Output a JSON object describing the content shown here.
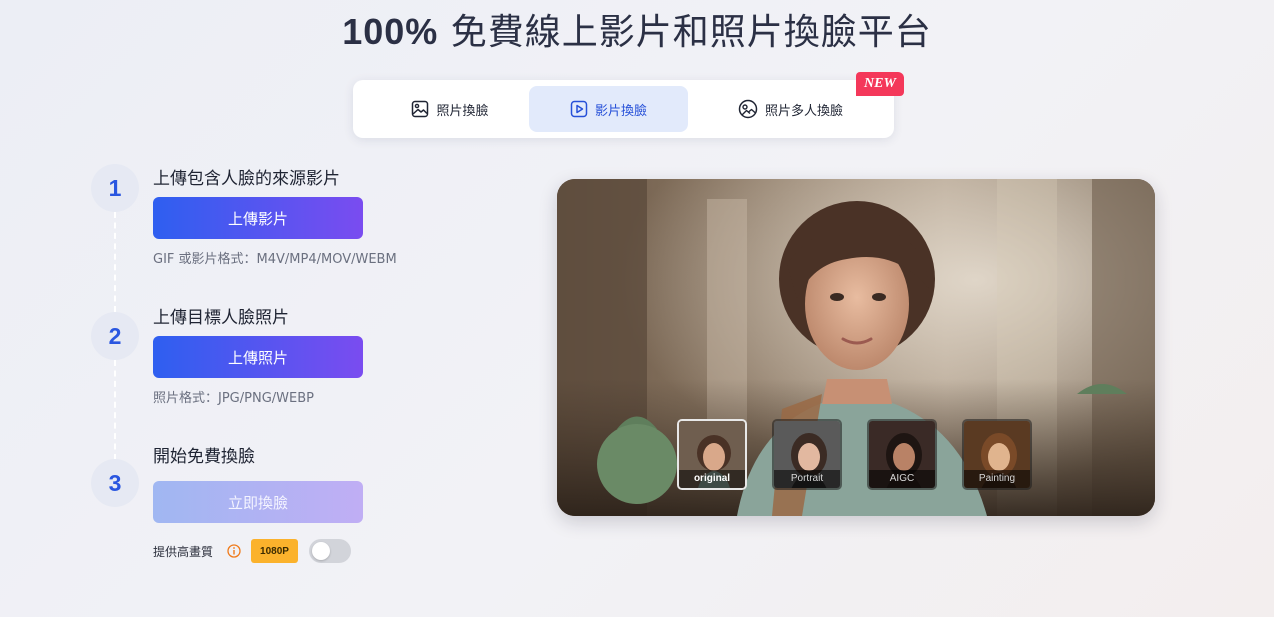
{
  "page": {
    "title_pct": "100%",
    "title_rest": " 免費線上影片和照片換臉平台"
  },
  "tabs": [
    {
      "label": "照片換臉",
      "icon": "image-icon",
      "active": false
    },
    {
      "label": "影片換臉",
      "icon": "video-play-icon",
      "active": true
    },
    {
      "label": "照片多人換臉",
      "icon": "multi-face-icon",
      "active": false,
      "badge": "NEW"
    }
  ],
  "steps": [
    {
      "number": "1",
      "title": "上傳包含人臉的來源影片",
      "button": "上傳影片",
      "hint": "GIF 或影片格式：M4V/MP4/MOV/WEBM"
    },
    {
      "number": "2",
      "title": "上傳目標人臉照片",
      "button": "上傳照片",
      "hint": "照片格式：JPG/PNG/WEBP"
    },
    {
      "number": "3",
      "title": "開始免費換臉",
      "button": "立即換臉"
    }
  ],
  "hd": {
    "label": "提供高畫質",
    "badge": "1080P",
    "enabled": false
  },
  "preview": {
    "thumbnails": [
      {
        "label": "original",
        "active": true
      },
      {
        "label": "Portrait",
        "active": false
      },
      {
        "label": "AIGC",
        "active": false
      },
      {
        "label": "Painting",
        "active": false
      }
    ]
  },
  "colors": {
    "accent_blue": "#2e5ff0",
    "accent_purple": "#7a4cf0",
    "active_tab_bg": "#e2eafb",
    "new_badge": "#f4385a",
    "hd_badge": "#fbb22c"
  }
}
